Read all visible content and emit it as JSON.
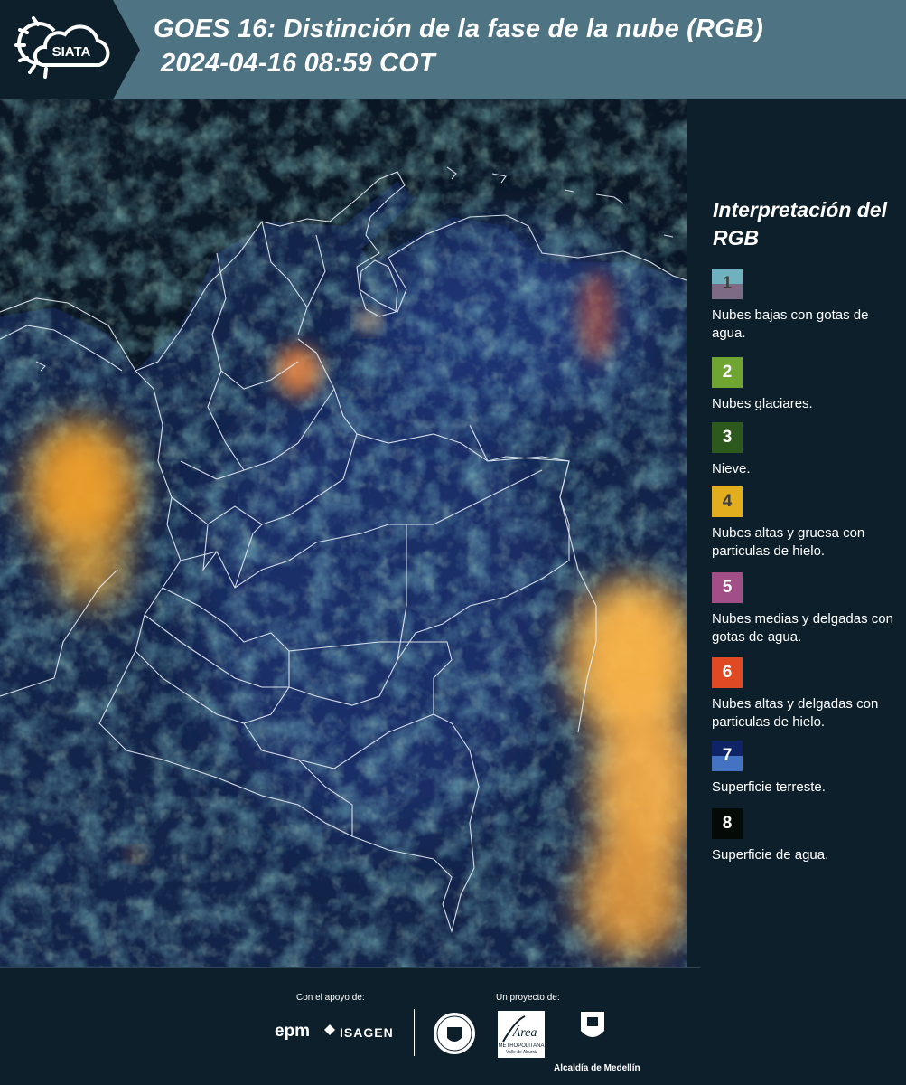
{
  "header": {
    "logo_text": "SIATA",
    "title_line1": "GOES 16: Distinción de la fase de la nube (RGB)",
    "title_line2": "2024-04-16 08:59 COT"
  },
  "legend": {
    "title": "Interpretación del RGB",
    "items": [
      {
        "number": "1",
        "top_color": "#6fb1be",
        "bottom_color": "#7d6b85",
        "num_color": "#3d3d3d",
        "description": "Nubes bajas con gotas de agua."
      },
      {
        "number": "2",
        "top_color": "#6fa631",
        "bottom_color": "#6fa631",
        "num_color": "#ffffff",
        "description": "Nubes glaciares."
      },
      {
        "number": "3",
        "top_color": "#2d5a1c",
        "bottom_color": "#2d5a1c",
        "num_color": "#ffffff",
        "description": "Nieve."
      },
      {
        "number": "4",
        "top_color": "#e2ae1d",
        "bottom_color": "#e2ae1d",
        "num_color": "#3d3d3d",
        "description": "Nubes altas y gruesa con particulas de hielo."
      },
      {
        "number": "5",
        "top_color": "#a14f86",
        "bottom_color": "#a14f86",
        "num_color": "#ffffff",
        "description": "Nubes medias y delgadas con gotas de agua."
      },
      {
        "number": "6",
        "top_color": "#df4a25",
        "bottom_color": "#df4a25",
        "num_color": "#ffffff",
        "description": "Nubes altas y delgadas con particulas de hielo."
      },
      {
        "number": "7",
        "top_color": "#0f2466",
        "bottom_color": "#4473c4",
        "num_color": "#ffffff",
        "description": "Superficie terreste."
      },
      {
        "number": "8",
        "top_color": "#040a06",
        "bottom_color": "#040a06",
        "num_color": "#ffffff",
        "description": "Superficie de agua."
      }
    ]
  },
  "footer": {
    "support_label": "Con el apoyo de:",
    "project_label": "Un proyecto de:",
    "epm": "epm",
    "isagen": "ISAGEN",
    "amva_top": "Área",
    "amva_line1": "METROPOLITANA",
    "amva_line2": "Valle de Aburrá",
    "alcaldia": "Alcaldía de Medellín"
  }
}
